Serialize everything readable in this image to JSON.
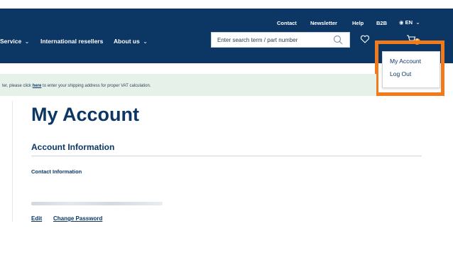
{
  "header": {
    "top_links": [
      "Contact",
      "Newsletter",
      "Help",
      "B2B",
      "EN"
    ],
    "nav": [
      {
        "label": "Service",
        "has_chevron": true
      },
      {
        "label": "International resellers",
        "has_chevron": false
      },
      {
        "label": "About us",
        "has_chevron": true
      }
    ],
    "search": {
      "placeholder": "Enter search term / part number"
    },
    "cart_badge": "0"
  },
  "account_menu": {
    "items": [
      "My Account",
      "Log Out"
    ]
  },
  "notice": {
    "prefix": "ter, please click ",
    "link": "here",
    "suffix": " to enter your shipping address for proper VAT calculation."
  },
  "main": {
    "title": "My Account",
    "section_title": "Account Information",
    "contact_label": "Contact Information",
    "edit_link": "Edit",
    "change_password_link": "Change Password"
  },
  "colors": {
    "header_bg": "#0c3765",
    "accent_highlight": "#f07a1c",
    "notice_bg": "#e6f2e9",
    "badge": "#f0a21c"
  }
}
